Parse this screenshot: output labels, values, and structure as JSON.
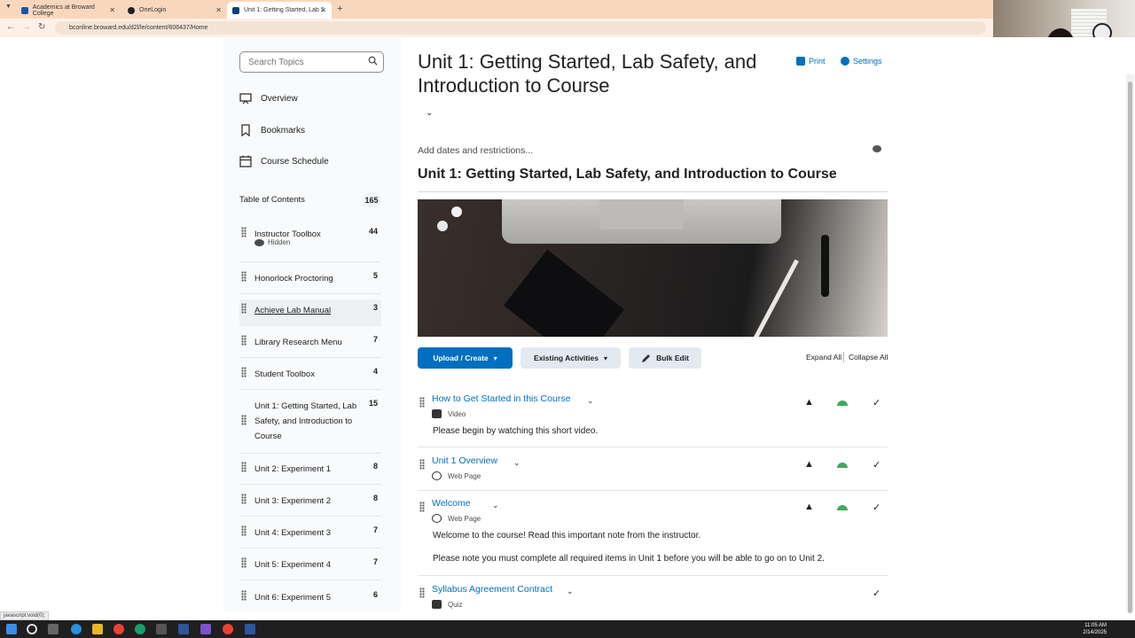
{
  "browser": {
    "tabs": [
      {
        "label": "Academics at Broward College",
        "color": "#1a56a6"
      },
      {
        "label": "OneLogin",
        "color": "#222222"
      },
      {
        "label": "Unit 1: Getting Started, Lab Safe",
        "color": "#0b3f79"
      }
    ],
    "url": "bconline.broward.edu/d2l/le/content/606437/Home"
  },
  "sidebar": {
    "search_placeholder": "Search Topics",
    "links": [
      "Overview",
      "Bookmarks",
      "Course Schedule"
    ],
    "toc_label": "Table of Contents",
    "toc_count": "165",
    "hidden_label": "Hidden",
    "modules": [
      {
        "label": "Instructor Toolbox",
        "count": "44"
      },
      {
        "label": "Honorlock Proctoring",
        "count": "5"
      },
      {
        "label": "Achieve Lab Manual",
        "count": "3"
      },
      {
        "label": "Library Research Menu",
        "count": "7"
      },
      {
        "label": "Student Toolbox",
        "count": "4"
      },
      {
        "label": "Unit 1: Getting Started, Lab Safety, and Introduction to Course",
        "count": "15"
      },
      {
        "label": "Unit 2: Experiment 1",
        "count": "8"
      },
      {
        "label": "Unit 3: Experiment 2",
        "count": "8"
      },
      {
        "label": "Unit 4: Experiment 3",
        "count": "7"
      },
      {
        "label": "Unit 5: Experiment 4",
        "count": "7"
      },
      {
        "label": "Unit 6: Experiment 5",
        "count": "6"
      }
    ]
  },
  "main": {
    "title": "Unit 1: Getting Started, Lab Safety, and Introduction to Course",
    "print_label": "Print",
    "settings_label": "Settings",
    "dates_label": "Add dates and restrictions...",
    "heading": "Unit 1: Getting Started, Lab Safety, and Introduction to Course",
    "upload_label": "Upload / Create",
    "existing_label": "Existing Activities",
    "bulk_label": "Bulk Edit",
    "expand_label": "Expand All",
    "collapse_label": "Collapse All",
    "items": [
      {
        "title": "How to Get Started in this Course",
        "type": "Video",
        "desc": "Please begin by watching this short video."
      },
      {
        "title": "Unit 1 Overview",
        "type": "Web Page"
      },
      {
        "title": "Welcome",
        "type": "Web Page",
        "desc": "Welcome to the course! Read this important note from the instructor.",
        "desc2": "Please note you must complete all required items in Unit 1 before you will be able to go on to Unit 2."
      },
      {
        "title": "Syllabus Agreement Contract",
        "type": "Quiz"
      }
    ]
  },
  "status_link": "javascript:void(0);",
  "taskbar": {
    "time": "11:05 AM",
    "date": "2/14/2025"
  },
  "colors": {
    "accent": "#006fbf",
    "tabbar": "#f9d7bd",
    "green": "#46a661"
  }
}
